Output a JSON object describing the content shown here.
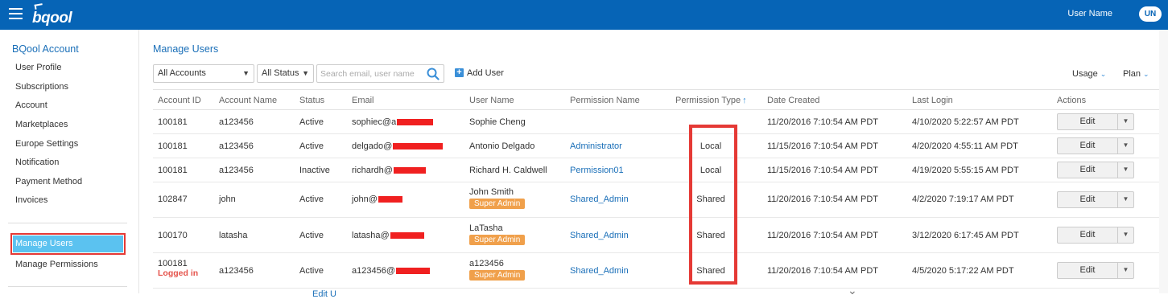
{
  "header": {
    "user_label": "User Name",
    "avatar_initials": "UN",
    "logo_text": "bqool"
  },
  "sidebar": {
    "title": "BQool Account",
    "items": [
      "User Profile",
      "Subscriptions",
      "Account",
      "Marketplaces",
      "Europe Settings",
      "Notification",
      "Payment Method",
      "Invoices"
    ],
    "active": "Manage Users",
    "after": "Manage Permissions"
  },
  "main": {
    "title": "Manage Users",
    "filters": {
      "accounts": "All Accounts",
      "status": "All Status",
      "search_placeholder": "Search email, user name",
      "add_user": "Add User",
      "usage": "Usage",
      "plan": "Plan"
    },
    "columns": [
      "Account ID",
      "Account Name",
      "Status",
      "Email",
      "User Name",
      "Permission Name",
      "Permission Type",
      "Date Created",
      "Last Login",
      "Actions"
    ],
    "rows": [
      {
        "id": "100181",
        "name": "a123456",
        "status": "Active",
        "email": "sophiec@a",
        "user": "Sophie Cheng",
        "badge": "",
        "perm_name": "",
        "perm_type": "",
        "created": "11/20/2016 7:10:54 AM PDT",
        "last": "4/10/2020 5:22:57 AM PDT",
        "note": ""
      },
      {
        "id": "100181",
        "name": "a123456",
        "status": "Active",
        "email": "delgado@",
        "user": "Antonio Delgado",
        "badge": "",
        "perm_name": "Administrator",
        "perm_type": "Local",
        "created": "11/15/2016 7:10:54 AM PDT",
        "last": "4/20/2020 4:55:11 AM PDT",
        "note": ""
      },
      {
        "id": "100181",
        "name": "a123456",
        "status": "Inactive",
        "email": "richardh@",
        "user": "Richard H. Caldwell",
        "badge": "",
        "perm_name": "Permission01",
        "perm_type": "Local",
        "created": "11/15/2016 7:10:54 AM PDT",
        "last": "4/19/2020 5:55:15 AM PDT",
        "note": ""
      },
      {
        "id": "102847",
        "name": "john",
        "status": "Active",
        "email": "john@",
        "user": "John Smith",
        "badge": "Super Admin",
        "perm_name": "Shared_Admin",
        "perm_type": "Shared",
        "created": "11/20/2016 7:10:54 AM PDT",
        "last": "4/2/2020 7:19:17 AM PDT",
        "note": ""
      },
      {
        "id": "100170",
        "name": "latasha",
        "status": "Active",
        "email": "latasha@",
        "user": "LaTasha",
        "badge": "Super Admin",
        "perm_name": "Shared_Admin",
        "perm_type": "Shared",
        "created": "11/20/2016 7:10:54 AM PDT",
        "last": "3/12/2020 6:17:45 AM PDT",
        "note": ""
      },
      {
        "id": "100181",
        "name": "a123456",
        "status": "Active",
        "email": "a123456@",
        "user": "a123456",
        "badge": "Super Admin",
        "perm_name": "Shared_Admin",
        "perm_type": "Shared",
        "created": "11/20/2016 7:10:54 AM PDT",
        "last": "4/5/2020 5:17:22 AM PDT",
        "note": "Logged in"
      }
    ],
    "edit_label": "Edit",
    "bottom_peek": "Edit U"
  },
  "colors": {
    "brand": "#0664b6",
    "accent": "#1a6fb8",
    "badge": "#f0a04b",
    "highlight": "#e53935",
    "sidebar_active": "#5bc2f0"
  }
}
